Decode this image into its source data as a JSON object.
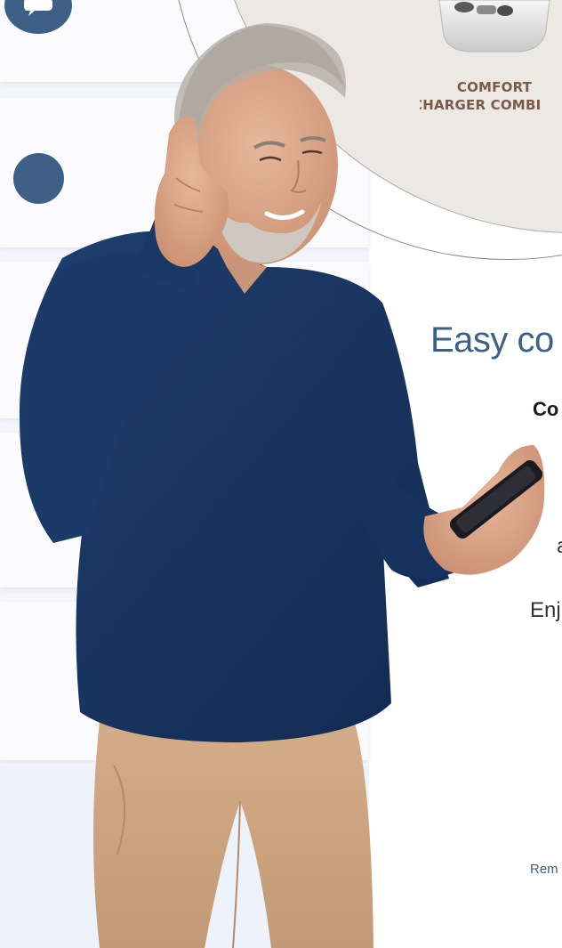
{
  "product": {
    "label_line1": "COMFORT",
    "label_line2": "CHARGER COMBI"
  },
  "content": {
    "heading": "Easy co",
    "subheading": "Co",
    "body_fragment_1": "a",
    "body_fragment_2": "Enj",
    "footnote": "Rem"
  },
  "icons": {
    "chat": "chat-bubble-icon",
    "dot": "circle-dot-icon"
  },
  "colors": {
    "accent_blue": "#3e5f86",
    "product_label_brown": "#7a5a48",
    "circle_bg": "#ece8e4"
  }
}
